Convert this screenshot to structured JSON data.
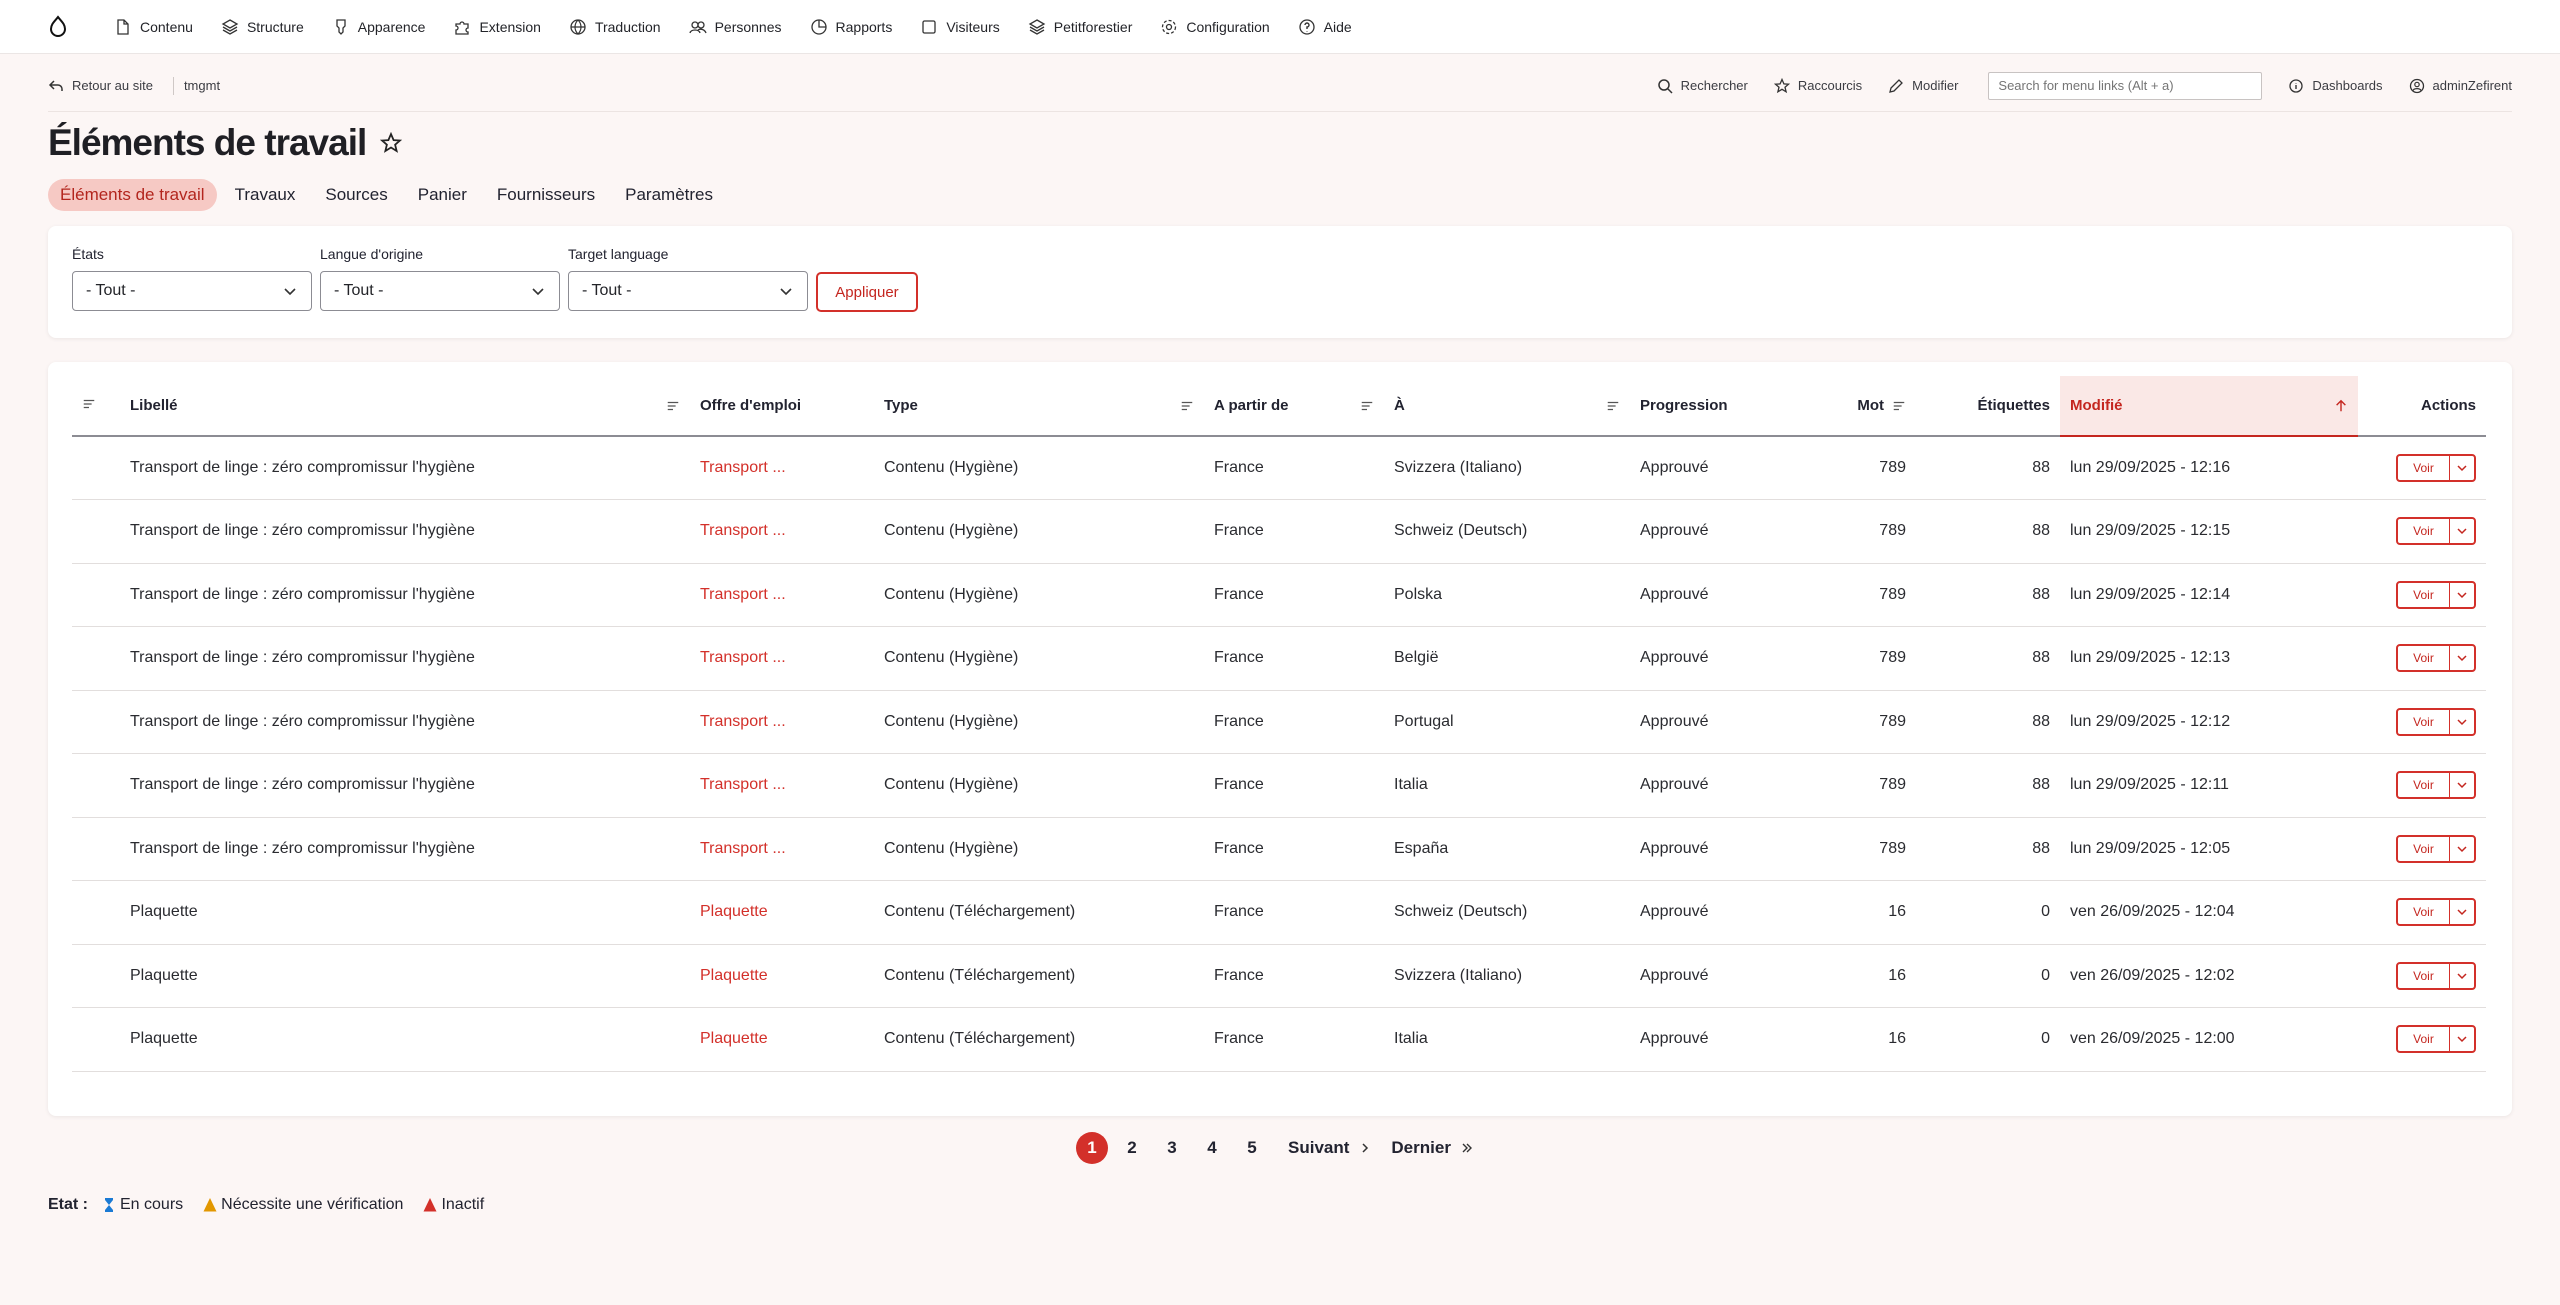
{
  "toolbar": {
    "items": [
      {
        "label": "Contenu",
        "icon": "file-icon"
      },
      {
        "label": "Structure",
        "icon": "layers-icon"
      },
      {
        "label": "Apparence",
        "icon": "brush-icon"
      },
      {
        "label": "Extension",
        "icon": "puzzle-icon"
      },
      {
        "label": "Traduction",
        "icon": "globe-icon"
      },
      {
        "label": "Personnes",
        "icon": "people-icon"
      },
      {
        "label": "Rapports",
        "icon": "chart-icon"
      },
      {
        "label": "Visiteurs",
        "icon": "square-icon"
      },
      {
        "label": "Petitforestier",
        "icon": "layers-icon"
      },
      {
        "label": "Configuration",
        "icon": "gear-icon"
      },
      {
        "label": "Aide",
        "icon": "help-icon"
      }
    ]
  },
  "secondary": {
    "back": "Retour au site",
    "site": "tmgmt",
    "search_label": "Rechercher",
    "shortcuts": "Raccourcis",
    "edit": "Modifier",
    "search_placeholder": "Search for menu links (Alt + a)",
    "dashboards": "Dashboards",
    "user": "adminZefirent"
  },
  "page": {
    "title": "Éléments de travail"
  },
  "tabs": [
    {
      "label": "Éléments de travail",
      "active": true
    },
    {
      "label": "Travaux",
      "active": false
    },
    {
      "label": "Sources",
      "active": false
    },
    {
      "label": "Panier",
      "active": false
    },
    {
      "label": "Fournisseurs",
      "active": false
    },
    {
      "label": "Paramètres",
      "active": false
    }
  ],
  "filters": {
    "states_label": "États",
    "states_value": "- Tout -",
    "source_label": "Langue d'origine",
    "source_value": "- Tout -",
    "target_label": "Target language",
    "target_value": "- Tout -",
    "apply": "Appliquer"
  },
  "table": {
    "headers": {
      "label": "Libellé",
      "job": "Offre d'emploi",
      "type": "Type",
      "from": "A partir de",
      "to": "À",
      "progress": "Progression",
      "words": "Mot",
      "tags": "Étiquettes",
      "changed": "Modifié",
      "actions": "Actions"
    },
    "action_label": "Voir",
    "rows": [
      {
        "label": "Transport de linge : zéro compromissur l'hygiène",
        "job": "Transport ...",
        "type": "Contenu (Hygiène)",
        "from": "France",
        "to": "Svizzera (Italiano)",
        "progress": "Approuvé",
        "words": "789",
        "tags": "88",
        "changed": "lun 29/09/2025 - 12:16"
      },
      {
        "label": "Transport de linge : zéro compromissur l'hygiène",
        "job": "Transport ...",
        "type": "Contenu (Hygiène)",
        "from": "France",
        "to": "Schweiz (Deutsch)",
        "progress": "Approuvé",
        "words": "789",
        "tags": "88",
        "changed": "lun 29/09/2025 - 12:15"
      },
      {
        "label": "Transport de linge : zéro compromissur l'hygiène",
        "job": "Transport ...",
        "type": "Contenu (Hygiène)",
        "from": "France",
        "to": "Polska",
        "progress": "Approuvé",
        "words": "789",
        "tags": "88",
        "changed": "lun 29/09/2025 - 12:14"
      },
      {
        "label": "Transport de linge : zéro compromissur l'hygiène",
        "job": "Transport ...",
        "type": "Contenu (Hygiène)",
        "from": "France",
        "to": "België",
        "progress": "Approuvé",
        "words": "789",
        "tags": "88",
        "changed": "lun 29/09/2025 - 12:13"
      },
      {
        "label": "Transport de linge : zéro compromissur l'hygiène",
        "job": "Transport ...",
        "type": "Contenu (Hygiène)",
        "from": "France",
        "to": "Portugal",
        "progress": "Approuvé",
        "words": "789",
        "tags": "88",
        "changed": "lun 29/09/2025 - 12:12"
      },
      {
        "label": "Transport de linge : zéro compromissur l'hygiène",
        "job": "Transport ...",
        "type": "Contenu (Hygiène)",
        "from": "France",
        "to": "Italia",
        "progress": "Approuvé",
        "words": "789",
        "tags": "88",
        "changed": "lun 29/09/2025 - 12:11"
      },
      {
        "label": "Transport de linge : zéro compromissur l'hygiène",
        "job": "Transport ...",
        "type": "Contenu (Hygiène)",
        "from": "France",
        "to": "España",
        "progress": "Approuvé",
        "words": "789",
        "tags": "88",
        "changed": "lun 29/09/2025 - 12:05"
      },
      {
        "label": "Plaquette",
        "job": "Plaquette",
        "type": "Contenu (Téléchargement)",
        "from": "France",
        "to": "Schweiz (Deutsch)",
        "progress": "Approuvé",
        "words": "16",
        "tags": "0",
        "changed": "ven 26/09/2025 - 12:04"
      },
      {
        "label": "Plaquette",
        "job": "Plaquette",
        "type": "Contenu (Téléchargement)",
        "from": "France",
        "to": "Svizzera (Italiano)",
        "progress": "Approuvé",
        "words": "16",
        "tags": "0",
        "changed": "ven 26/09/2025 - 12:02"
      },
      {
        "label": "Plaquette",
        "job": "Plaquette",
        "type": "Contenu (Téléchargement)",
        "from": "France",
        "to": "Italia",
        "progress": "Approuvé",
        "words": "16",
        "tags": "0",
        "changed": "ven 26/09/2025 - 12:00"
      }
    ]
  },
  "pager": {
    "pages": [
      "1",
      "2",
      "3",
      "4",
      "5"
    ],
    "current": "1",
    "next": "Suivant",
    "last": "Dernier"
  },
  "legend": {
    "title": "Etat :",
    "items": [
      {
        "label": "En cours",
        "icon": "hourglass-icon",
        "color": "#1a7ad4"
      },
      {
        "label": "Nécessite une vérification",
        "icon": "warning-icon",
        "color": "#e29700"
      },
      {
        "label": "Inactif",
        "icon": "warning-icon",
        "color": "#d3302a"
      }
    ]
  },
  "colors": {
    "accent": "#d3302a",
    "tab_active_bg": "#f6c9c4",
    "background": "#fcf6f5"
  }
}
